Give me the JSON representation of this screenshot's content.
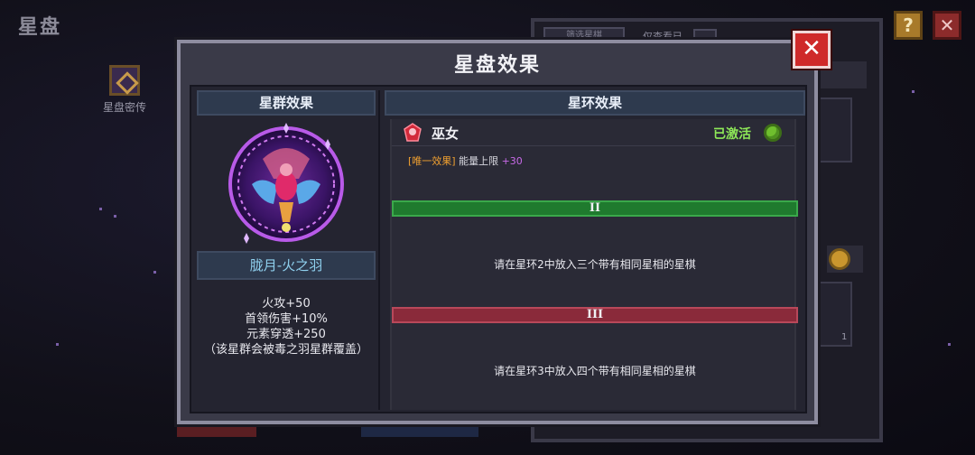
{
  "screen": {
    "title": "星盘",
    "help_label": "?",
    "close_label": "✕"
  },
  "background": {
    "secret_label": "星盘密传",
    "filter_tab_label": "筛选星棋",
    "only_show_label": "仅查看已",
    "count": "1"
  },
  "dialog": {
    "title": "星盘效果",
    "close_label": "✕",
    "cluster": {
      "header": "星群效果",
      "name": "胧月-火之羽",
      "bonuses": [
        "火攻+50",
        "首领伤害+10%",
        "元素穿透+250",
        "（该星群会被毒之羽星群覆盖）"
      ]
    },
    "ring": {
      "header": "星环效果",
      "effect_icon": "red-gem-icon",
      "effect_name": "巫女",
      "effect_status": "已激活",
      "effect_tag": "[唯一效果]",
      "effect_text": "能量上限",
      "effect_value": "+30",
      "ring2_numeral": "II",
      "ring2_color": "#1f7a2e",
      "ring2_desc": "请在星环2中放入三个带有相同星相的星棋",
      "ring3_numeral": "III",
      "ring3_color": "#8a2a3a",
      "ring3_desc": "请在星环3中放入四个带有相同星相的星棋"
    }
  },
  "colors": {
    "status_green": "#8ee858",
    "name_cyan": "#8fd0ee",
    "close_red": "#cf2a2a"
  }
}
